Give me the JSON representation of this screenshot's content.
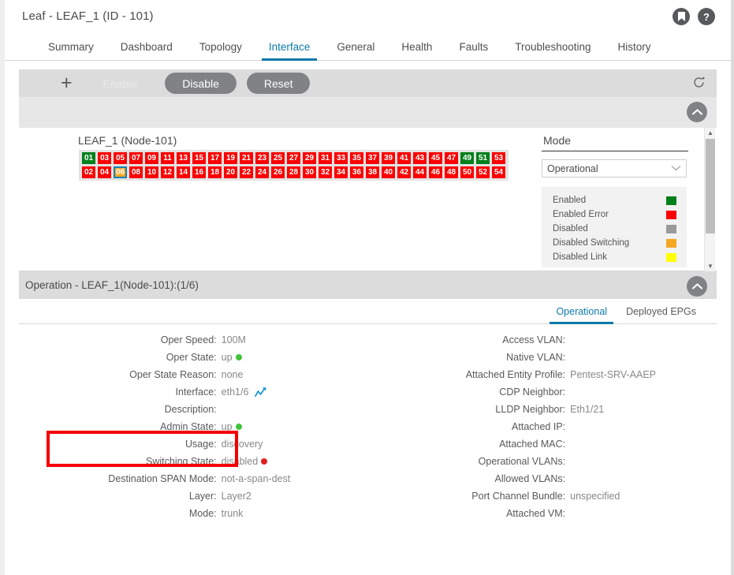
{
  "header": {
    "title": "Leaf - LEAF_1 (ID - 101)",
    "bookmark_icon": "bookmark-icon",
    "help_icon": "help-icon",
    "help_glyph": "?"
  },
  "tabs": [
    {
      "label": "Summary",
      "active": false
    },
    {
      "label": "Dashboard",
      "active": false
    },
    {
      "label": "Topology",
      "active": false
    },
    {
      "label": "Interface",
      "active": true
    },
    {
      "label": "General",
      "active": false
    },
    {
      "label": "Health",
      "active": false
    },
    {
      "label": "Faults",
      "active": false
    },
    {
      "label": "Troubleshooting",
      "active": false
    },
    {
      "label": "History",
      "active": false
    }
  ],
  "toolbar": {
    "menu_icon": "hamburger-menu-icon",
    "add_icon": "plus-icon",
    "plus_glyph": "+",
    "enable_label": "Enable",
    "disable_label": "Disable",
    "reset_label": "Reset",
    "refresh_icon": "refresh-icon"
  },
  "topology": {
    "node_title": "LEAF_1 (Node-101)",
    "collapse_icon": "chevron-up-icon",
    "ports_odd": [
      {
        "n": "01",
        "state": "enabled"
      },
      {
        "n": "03",
        "state": "enabled-error"
      },
      {
        "n": "05",
        "state": "enabled-error"
      },
      {
        "n": "07",
        "state": "enabled-error"
      },
      {
        "n": "09",
        "state": "enabled-error"
      },
      {
        "n": "11",
        "state": "enabled-error"
      },
      {
        "n": "13",
        "state": "enabled-error"
      },
      {
        "n": "15",
        "state": "enabled-error"
      },
      {
        "n": "17",
        "state": "enabled-error"
      },
      {
        "n": "19",
        "state": "enabled-error"
      },
      {
        "n": "21",
        "state": "enabled-error"
      },
      {
        "n": "23",
        "state": "enabled-error"
      },
      {
        "n": "25",
        "state": "enabled-error"
      },
      {
        "n": "27",
        "state": "enabled-error"
      },
      {
        "n": "29",
        "state": "enabled-error"
      },
      {
        "n": "31",
        "state": "enabled-error"
      },
      {
        "n": "33",
        "state": "enabled-error"
      },
      {
        "n": "35",
        "state": "enabled-error"
      },
      {
        "n": "37",
        "state": "enabled-error"
      },
      {
        "n": "39",
        "state": "enabled-error"
      },
      {
        "n": "41",
        "state": "enabled-error"
      },
      {
        "n": "43",
        "state": "enabled-error"
      },
      {
        "n": "45",
        "state": "enabled-error"
      },
      {
        "n": "47",
        "state": "enabled-error"
      },
      {
        "n": "49",
        "state": "enabled"
      },
      {
        "n": "51",
        "state": "enabled"
      },
      {
        "n": "53",
        "state": "enabled-error"
      }
    ],
    "ports_even": [
      {
        "n": "02",
        "state": "enabled-error"
      },
      {
        "n": "04",
        "state": "enabled-error"
      },
      {
        "n": "06",
        "state": "disabled-switching",
        "selected": true
      },
      {
        "n": "08",
        "state": "enabled-error"
      },
      {
        "n": "10",
        "state": "enabled-error"
      },
      {
        "n": "12",
        "state": "enabled-error"
      },
      {
        "n": "14",
        "state": "enabled-error"
      },
      {
        "n": "16",
        "state": "enabled-error"
      },
      {
        "n": "18",
        "state": "enabled-error"
      },
      {
        "n": "20",
        "state": "enabled-error"
      },
      {
        "n": "22",
        "state": "enabled-error"
      },
      {
        "n": "24",
        "state": "enabled-error"
      },
      {
        "n": "26",
        "state": "enabled-error"
      },
      {
        "n": "28",
        "state": "enabled-error"
      },
      {
        "n": "30",
        "state": "enabled-error"
      },
      {
        "n": "32",
        "state": "enabled-error"
      },
      {
        "n": "34",
        "state": "enabled-error"
      },
      {
        "n": "36",
        "state": "enabled-error"
      },
      {
        "n": "38",
        "state": "enabled-error"
      },
      {
        "n": "40",
        "state": "enabled-error"
      },
      {
        "n": "42",
        "state": "enabled-error"
      },
      {
        "n": "44",
        "state": "enabled-error"
      },
      {
        "n": "46",
        "state": "enabled-error"
      },
      {
        "n": "48",
        "state": "enabled-error"
      },
      {
        "n": "50",
        "state": "enabled-error"
      },
      {
        "n": "52",
        "state": "enabled-error"
      },
      {
        "n": "54",
        "state": "enabled-error"
      }
    ],
    "state_colors": {
      "enabled": "#00801b",
      "enabled-error": "#fc0000",
      "disabled": "#9a9a9a",
      "disabled-switching": "#fca61e",
      "disabled-link": "#ffff00"
    },
    "selection_color": "#1283b8"
  },
  "mode_panel": {
    "label": "Mode",
    "selected": "Operational",
    "chevron": "⌄",
    "legend": [
      {
        "label": "Enabled",
        "color": "#00801b"
      },
      {
        "label": "Enabled Error",
        "color": "#fc0000"
      },
      {
        "label": "Disabled",
        "color": "#9a9a9a"
      },
      {
        "label": "Disabled Switching",
        "color": "#f5a623"
      },
      {
        "label": "Disabled Link",
        "color": "#ffff00"
      }
    ]
  },
  "operation": {
    "title": "Operation - LEAF_1(Node-101):(1/6)",
    "collapse_icon": "chevron-up-icon",
    "tabs": [
      {
        "label": "Operational",
        "active": true
      },
      {
        "label": "Deployed EPGs",
        "active": false
      }
    ],
    "left_fields": [
      {
        "label": "Oper Speed:",
        "value": "100M"
      },
      {
        "label": "Oper State:",
        "value": "up",
        "dot": "#44c23c"
      },
      {
        "label": "Oper State Reason:",
        "value": "none"
      },
      {
        "label": "Interface:",
        "value": "eth1/6",
        "trend": true
      },
      {
        "label": "Description:",
        "value": ""
      },
      {
        "label": "Admin State:",
        "value": "up",
        "dot": "#44c23c"
      },
      {
        "label": "Usage:",
        "value": "discovery"
      },
      {
        "label": "Switching State:",
        "value": "disabled",
        "dot": "#e02020"
      },
      {
        "label": "Destination SPAN Mode:",
        "value": "not-a-span-dest"
      },
      {
        "label": "Layer:",
        "value": "Layer2"
      },
      {
        "label": "Mode:",
        "value": "trunk"
      }
    ],
    "right_fields": [
      {
        "label": "Access VLAN:",
        "value": ""
      },
      {
        "label": "Native VLAN:",
        "value": ""
      },
      {
        "label": "Attached Entity Profile:",
        "value": "Pentest-SRV-AAEP"
      },
      {
        "label": "CDP Neighbor:",
        "value": ""
      },
      {
        "label": "LLDP Neighbor:",
        "value": "Eth1/21"
      },
      {
        "label": "Attached IP:",
        "value": ""
      },
      {
        "label": "Attached MAC:",
        "value": ""
      },
      {
        "label": "Operational VLANs:",
        "value": ""
      },
      {
        "label": "Allowed VLANs:",
        "value": ""
      },
      {
        "label": "Port Channel Bundle:",
        "value": "unspecified"
      },
      {
        "label": "Attached VM:",
        "value": ""
      }
    ],
    "highlight_color": "#f40000"
  }
}
